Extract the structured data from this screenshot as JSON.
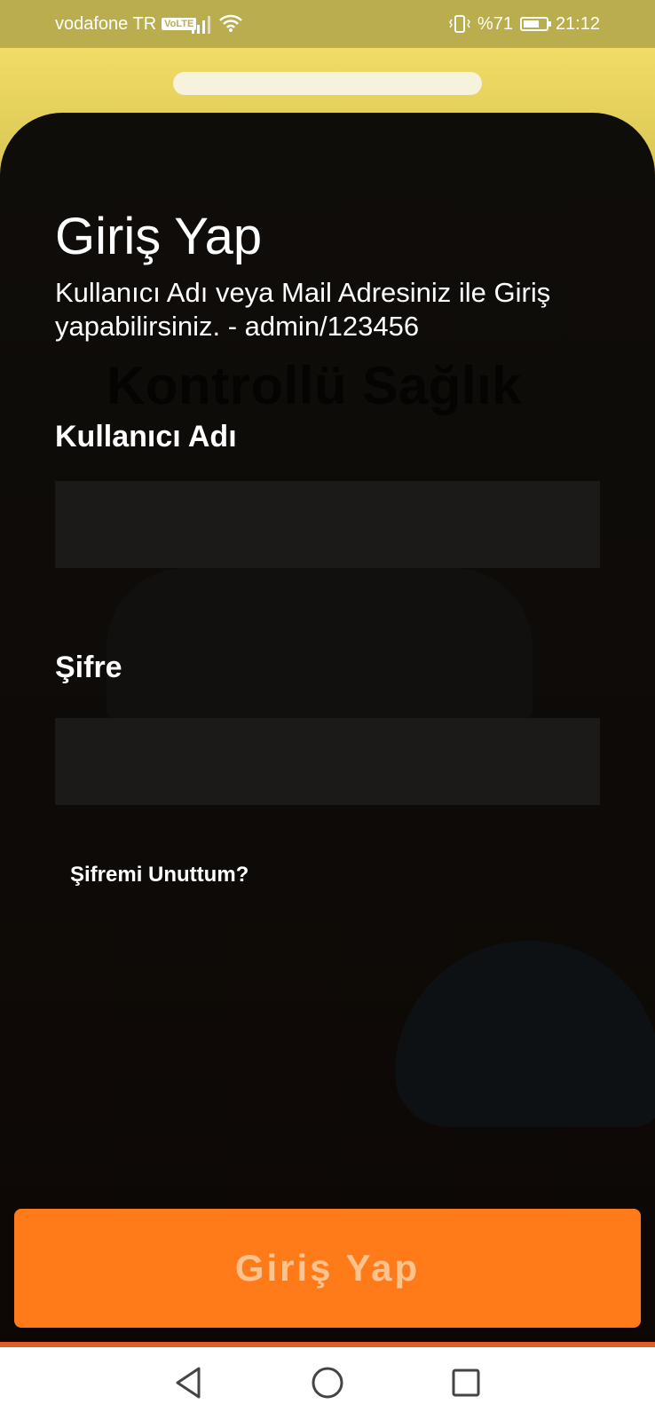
{
  "status_bar": {
    "carrier": "vodafone TR",
    "volte_badge": "VoLTE",
    "battery_text": "%71",
    "battery_level": 0.71,
    "time": "21:12"
  },
  "background": {
    "watermark_text": "Kontrollü Sağlık"
  },
  "login": {
    "title": "Giriş Yap",
    "subtitle": "Kullanıcı Adı veya Mail Adresiniz ile Giriş yapabilirsiniz. - admin/123456",
    "username_label": "Kullanıcı Adı",
    "username_value": "",
    "password_label": "Şifre",
    "password_value": "",
    "forgot_password": "Şifremi Unuttum?",
    "submit_label": "Giriş Yap"
  },
  "colors": {
    "status_bar": "#b9ad4e",
    "top_sheet": "#f0dc66",
    "card_background": "#0f0d0a",
    "input_background": "#1c1a19",
    "accent": "#ff7b1a",
    "button_text": "#fcc38f"
  },
  "nav_bar": {
    "icons": [
      "back-icon",
      "home-icon",
      "recents-icon"
    ]
  }
}
